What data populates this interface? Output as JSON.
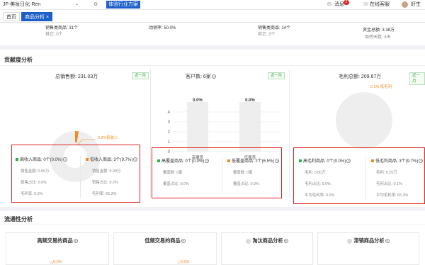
{
  "header": {
    "shop_name": "JF-美妆日化-Ren",
    "experience_btn": "体验行业方案",
    "message_label": "消息",
    "message_count": "2",
    "service_label": "在线客服",
    "user_name": "好生"
  },
  "tabs": [
    {
      "label": "首页"
    },
    {
      "label": "商品分析 ×"
    }
  ],
  "stats": {
    "sold_label": "销售类商品: 31个",
    "other_label": "其它: 0个",
    "move_label": "动销率: 50.0%",
    "sold2_label": "销售类商品: 14个",
    "other2_label": "其它: 0个",
    "fund_label": "资金总额: 3.38万",
    "turnover_label": "周转天数: 4天"
  },
  "contribution": {
    "title": "贡献度分析",
    "sales": {
      "title": "总销售额: 231.03万",
      "period": "近一月",
      "low_label": "0.2%低收入",
      "high": {
        "label": "高收入商品: 0个(0.0%)",
        "amount": "销售金额: 0.00万",
        "ratio": "销售占比: 0.0%",
        "margin": "毛利率: 0.0%"
      },
      "low": {
        "label": "低收入商品: 3个(9.7%)",
        "amount": "销售金额: 0.39万",
        "ratio": "销售占比: 0.2%",
        "margin": "毛利率: 65.3%"
      }
    },
    "customers": {
      "title": "客户数: 6家",
      "period": "近一月",
      "bar_labels": [
        "0.0%",
        "0.0%"
      ],
      "categories": [
        "高覆盖",
        "低覆盖"
      ],
      "ticks": [
        "4",
        "3",
        "2",
        "1",
        "0"
      ],
      "high": {
        "label": "高覆盖商品: 0个(0.0%)",
        "count": "覆盖数: 0家",
        "ratio": "覆盖占比: 0.0%"
      },
      "low": {
        "label": "低覆盖商品: 2个(6.5%)",
        "count": "覆盖数: 0家",
        "ratio": "覆盖占比: 0.0%"
      }
    },
    "profit": {
      "title": "毛利总额: 209.67万",
      "period": "近一月",
      "low_label": "0.1% 低毛利",
      "high": {
        "label": "高毛利商品: 0个(0.0%)",
        "amount": "毛利: 0.00万",
        "ratio": "毛利占比: 0.0%",
        "margin": "平均毛利率: 0.0%"
      },
      "low": {
        "label": "低毛利商品: 3个(9.7%)",
        "amount": "毛利: 0.25万",
        "ratio": "毛利占比: 0.1%",
        "margin": "平均毛利率: 65.3%"
      }
    }
  },
  "liquidity": {
    "title": "流通性分析",
    "cards": [
      {
        "title": "高频交易的商品",
        "value": "△0.0%"
      },
      {
        "title": "低频交易的商品",
        "value": "△0.0%"
      },
      {
        "title": "淘汰商品分析"
      },
      {
        "title": "滞销商品分析"
      }
    ]
  },
  "colors": {
    "accent": "#1d5fc9",
    "highlight": "#e02424",
    "orange": "#f38b1f",
    "green": "#2bb34b"
  }
}
